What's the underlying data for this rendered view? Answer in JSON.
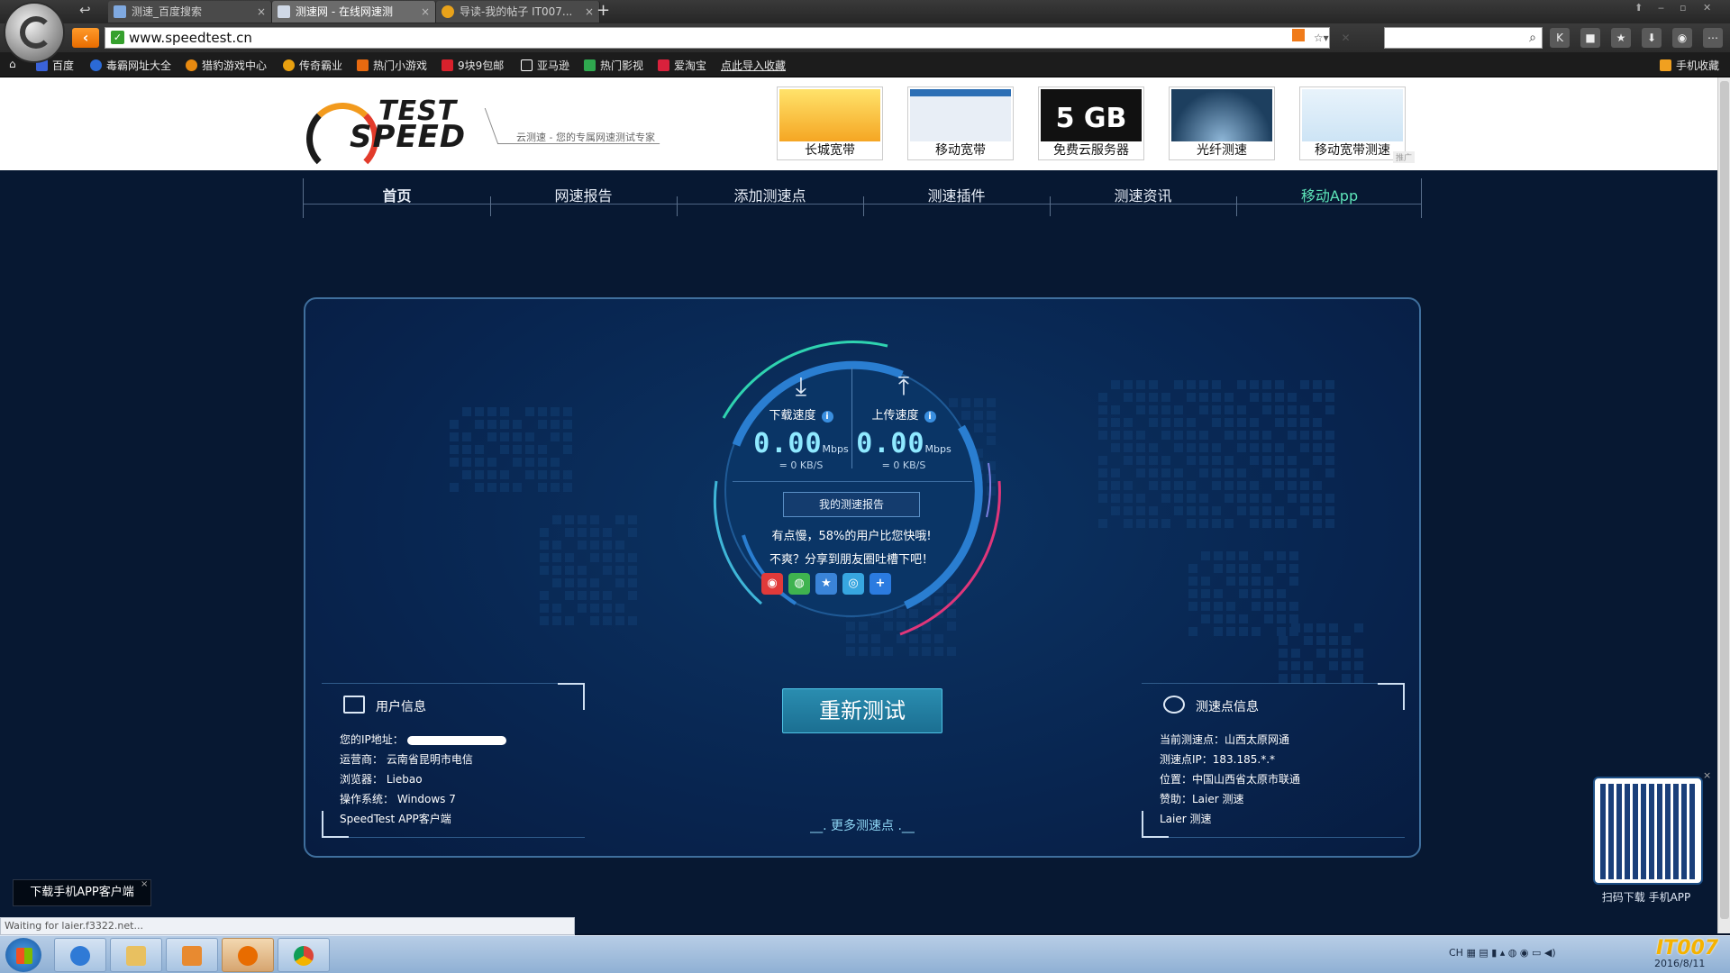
{
  "browser": {
    "tabs": [
      {
        "label": "测速_百度搜索",
        "active": false
      },
      {
        "label": "测速网 - 在线网速测",
        "active": true
      },
      {
        "label": "导读-我的帖子 IT007...",
        "active": false
      }
    ],
    "new_tab": "+",
    "url": "www.speedtest.cn",
    "favorites": [
      "百度",
      "毒霸网址大全",
      "猎豹游戏中心",
      "传奇霸业",
      "热门小游戏",
      "9块9包邮",
      "亚马逊",
      "热门影视",
      "爱淘宝",
      "点此导入收藏"
    ],
    "mobile_fav": "手机收藏",
    "status_text": "Waiting for laier.f3322.net..."
  },
  "site": {
    "logo_line1": "TEST",
    "logo_line2": "SPEED",
    "slogan": "云测速 - 您的专属网速测试专家",
    "ads": [
      "长城宽带",
      "移动宽带",
      "免费云服务器",
      "光纤测速",
      "移动宽带测速"
    ],
    "ad_5gb": "5 GB",
    "ad_tag": "推广",
    "nav": [
      "首页",
      "网速报告",
      "添加测速点",
      "测速插件",
      "测速资讯",
      "移动App"
    ]
  },
  "speed": {
    "download_label": "下载速度",
    "upload_label": "上传速度",
    "download_value": "0.00",
    "upload_value": "0.00",
    "unit": "Mbps",
    "download_kbs": "= 0 KB/S",
    "upload_kbs": "= 0 KB/S",
    "report_button": "我的测速报告",
    "slow_text": "有点慢，58%的用户比您快哦!",
    "share_text": "不爽？分享到朋友圈吐槽下吧！",
    "retest_button": "重新测试",
    "more_points": "__. 更多测速点 .__"
  },
  "user_info": {
    "title": "用户信息",
    "ip_label": "您的IP地址：",
    "isp": "运营商： 云南省昆明市电信",
    "browser": "浏览器： Liebao",
    "os": "操作系统： Windows 7",
    "client": "SpeedTest APP客户端"
  },
  "server_info": {
    "title": "测速点信息",
    "current": "当前测速点：山西太原网通",
    "ip": "测速点IP：183.185.*.*",
    "location": "位置：中国山西省太原市联通",
    "sponsor": "赞助：Laier 测速",
    "extra": "Laier 测速"
  },
  "qr_caption": "扫码下载 手机APP",
  "app_download": "下载手机APP客户端",
  "taskbar": {
    "tray_text": "CH",
    "date": "2016/8/11",
    "watermark": "IT007"
  },
  "colors": {
    "accent_orange": "#e86c00",
    "gauge_teal": "#2fd3b0",
    "gauge_blue": "#2f7fd8",
    "gauge_pink": "#e0367a",
    "speed_value": "#8fe9ff"
  }
}
